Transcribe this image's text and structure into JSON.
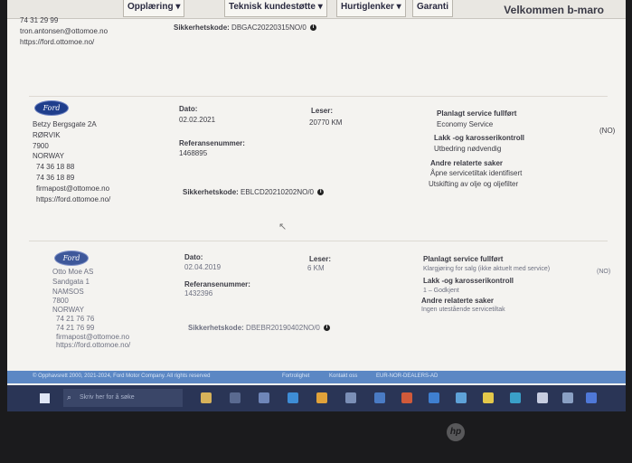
{
  "nav": {
    "items": [
      "Opplæring ▾",
      "Teknisk kundestøtte ▾",
      "Hurtiglenker ▾",
      "Garanti"
    ],
    "welcome": "Velkommen b-maro"
  },
  "top_block": {
    "phone": "74 31 29 99",
    "email": "tron.antonsen@ottomoe.no",
    "url": "https://ford.ottomoe.no/",
    "security_label": "Sikkerhetskode:",
    "security_code": "DBGAC20220315NO/0"
  },
  "records": [
    {
      "logo": "Ford",
      "address": [
        "Betzy Bergsgate 2A",
        "RØRVIK",
        "7900",
        "NORWAY",
        "74 36 18 88",
        "74 36 18 89",
        "firmapost@ottomoe.no",
        "https://ford.ottomoe.no/"
      ],
      "date_label": "Dato:",
      "date": "02.02.2021",
      "reader_label": "Leser:",
      "reader": "20770 KM",
      "ref_label": "Referansenummer:",
      "ref": "1468895",
      "security_label": "Sikkerhetskode:",
      "security_code": "EBLCD20210202NO/0",
      "planned_label": "Planlagt service fullført",
      "planned_value": "Economy Service",
      "planned_flag": "(NO)",
      "paint_label": "Lakk -og karosserikontroll",
      "paint_value": "Utbedring nødvendig",
      "related_label": "Andre relaterte saker",
      "related_values": [
        "Åpne servicetiltak identifisert",
        "Utskifting av olje og oljefilter"
      ]
    },
    {
      "logo": "Ford",
      "address": [
        "Otto Moe AS",
        "Sandgata 1",
        "NAMSOS",
        "7800",
        "NORWAY",
        "74 21 76 76",
        "74 21 76 99",
        "firmapost@ottomoe.no",
        "https://ford.ottomoe.no/"
      ],
      "date_label": "Dato:",
      "date": "02.04.2019",
      "reader_label": "Leser:",
      "reader": "6 KM",
      "ref_label": "Referansenummer:",
      "ref": "1432396",
      "security_label": "Sikkerhetskode:",
      "security_code": "DBEBR20190402NO/0",
      "planned_label": "Planlagt service fullført",
      "planned_value": "Klargjøring for salg (ikke aktuelt med service)",
      "planned_flag": "(NO)",
      "paint_label": "Lakk -og karosserikontroll",
      "paint_value": "1 – Godkjent",
      "related_label": "Andre relaterte saker",
      "related_values": [
        "Ingen utestående servicetiltak"
      ]
    }
  ],
  "footer": {
    "copyright": "© Opphavsrett 2000, 2021-2024, Ford Motor Company. All rights reserved",
    "links": [
      "Fortrolighet",
      "Kontakt oss",
      "EUR-NOR-DEALERS-AD"
    ]
  },
  "taskbar": {
    "search_placeholder": "Skriv her for å søke"
  },
  "bezel": {
    "brand": "hp"
  }
}
